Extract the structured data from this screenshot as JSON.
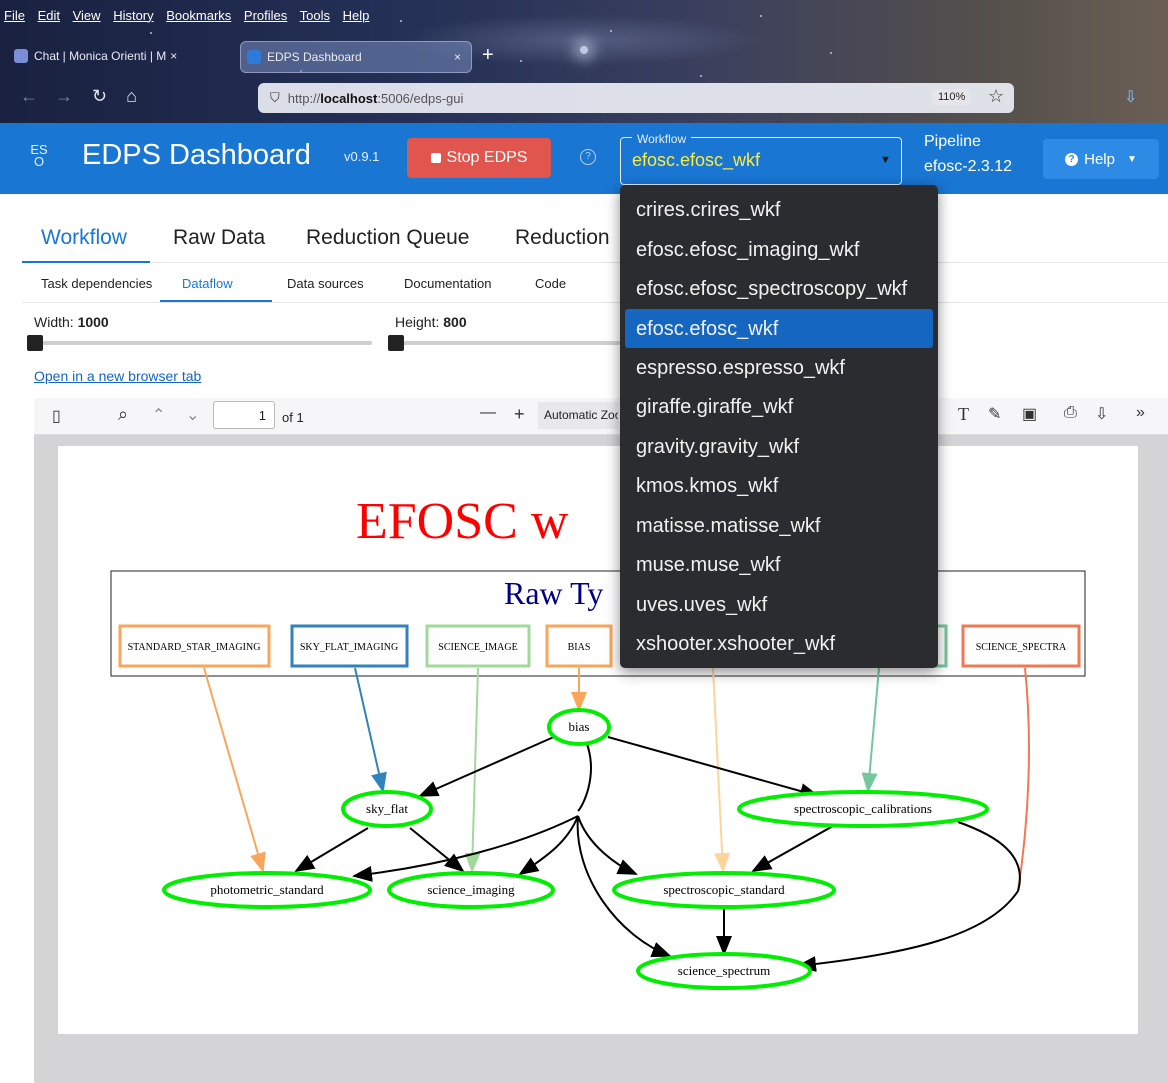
{
  "browser": {
    "menu": [
      "File",
      "Edit",
      "View",
      "History",
      "Bookmarks",
      "Profiles",
      "Tools",
      "Help"
    ],
    "tabs": [
      {
        "title": "Chat | Monica Orienti | M",
        "close": "×"
      },
      {
        "title": "EDPS Dashboard",
        "close": "×"
      }
    ],
    "new_tab": "+",
    "url_prefix": "http://",
    "url_host": "localhost",
    "url_rest": ":5006/edps-gui",
    "zoom": "110%"
  },
  "header": {
    "logo": "ES O",
    "title": "EDPS Dashboard",
    "version": "v0.9.1",
    "stop_button": "Stop EDPS",
    "help_q": "?",
    "workflow_legend": "Workflow",
    "workflow_value": "efosc.efosc_wkf",
    "pipeline_label": "Pipeline",
    "pipeline_value": "efosc-2.3.12",
    "help_button": "Help"
  },
  "main_tabs": [
    "Workflow",
    "Raw Data",
    "Reduction Queue",
    "Reduction"
  ],
  "sub_tabs": [
    "Task dependencies",
    "Dataflow",
    "Data sources",
    "Documentation",
    "Code"
  ],
  "sliders": {
    "width_label": "Width:",
    "width_value": "1000",
    "height_label": "Height:",
    "height_value": "800"
  },
  "open_link": "Open in a new browser tab",
  "pdf_toolbar": {
    "page": "1",
    "of_pages": "of 1",
    "zoom_select": "Automatic Zoom"
  },
  "diagram": {
    "title": "EFOSC w",
    "raw_types_title": "Raw Ty",
    "raw_types": [
      "STANDARD_STAR_IMAGING",
      "SKY_FLAT_IMAGING",
      "SCIENCE_IMAGE",
      "BIAS",
      "SCIENCE_SPECTRA"
    ],
    "tasks": [
      "bias",
      "sky_flat",
      "spectroscopic_calibrations",
      "photometric_standard",
      "science_imaging",
      "spectroscopic_standard",
      "science_spectrum"
    ]
  },
  "dropdown": {
    "options": [
      "crires.crires_wkf",
      "efosc.efosc_imaging_wkf",
      "efosc.efosc_spectroscopy_wkf",
      "efosc.efosc_wkf",
      "espresso.espresso_wkf",
      "giraffe.giraffe_wkf",
      "gravity.gravity_wkf",
      "kmos.kmos_wkf",
      "matisse.matisse_wkf",
      "muse.muse_wkf",
      "uves.uves_wkf",
      "xshooter.xshooter_wkf"
    ],
    "selected": "efosc.efosc_wkf"
  },
  "colors": {
    "app_blue": "#1976d2",
    "stop_red": "#e0554e",
    "workflow_yellow": "#ffeb3b",
    "dropdown_bg": "#2b2c2f",
    "selected_bg": "#1566c0",
    "diagram_title_red": "#ff0000",
    "raw_types_navy": "#000080",
    "task_green": "#00ee00"
  }
}
